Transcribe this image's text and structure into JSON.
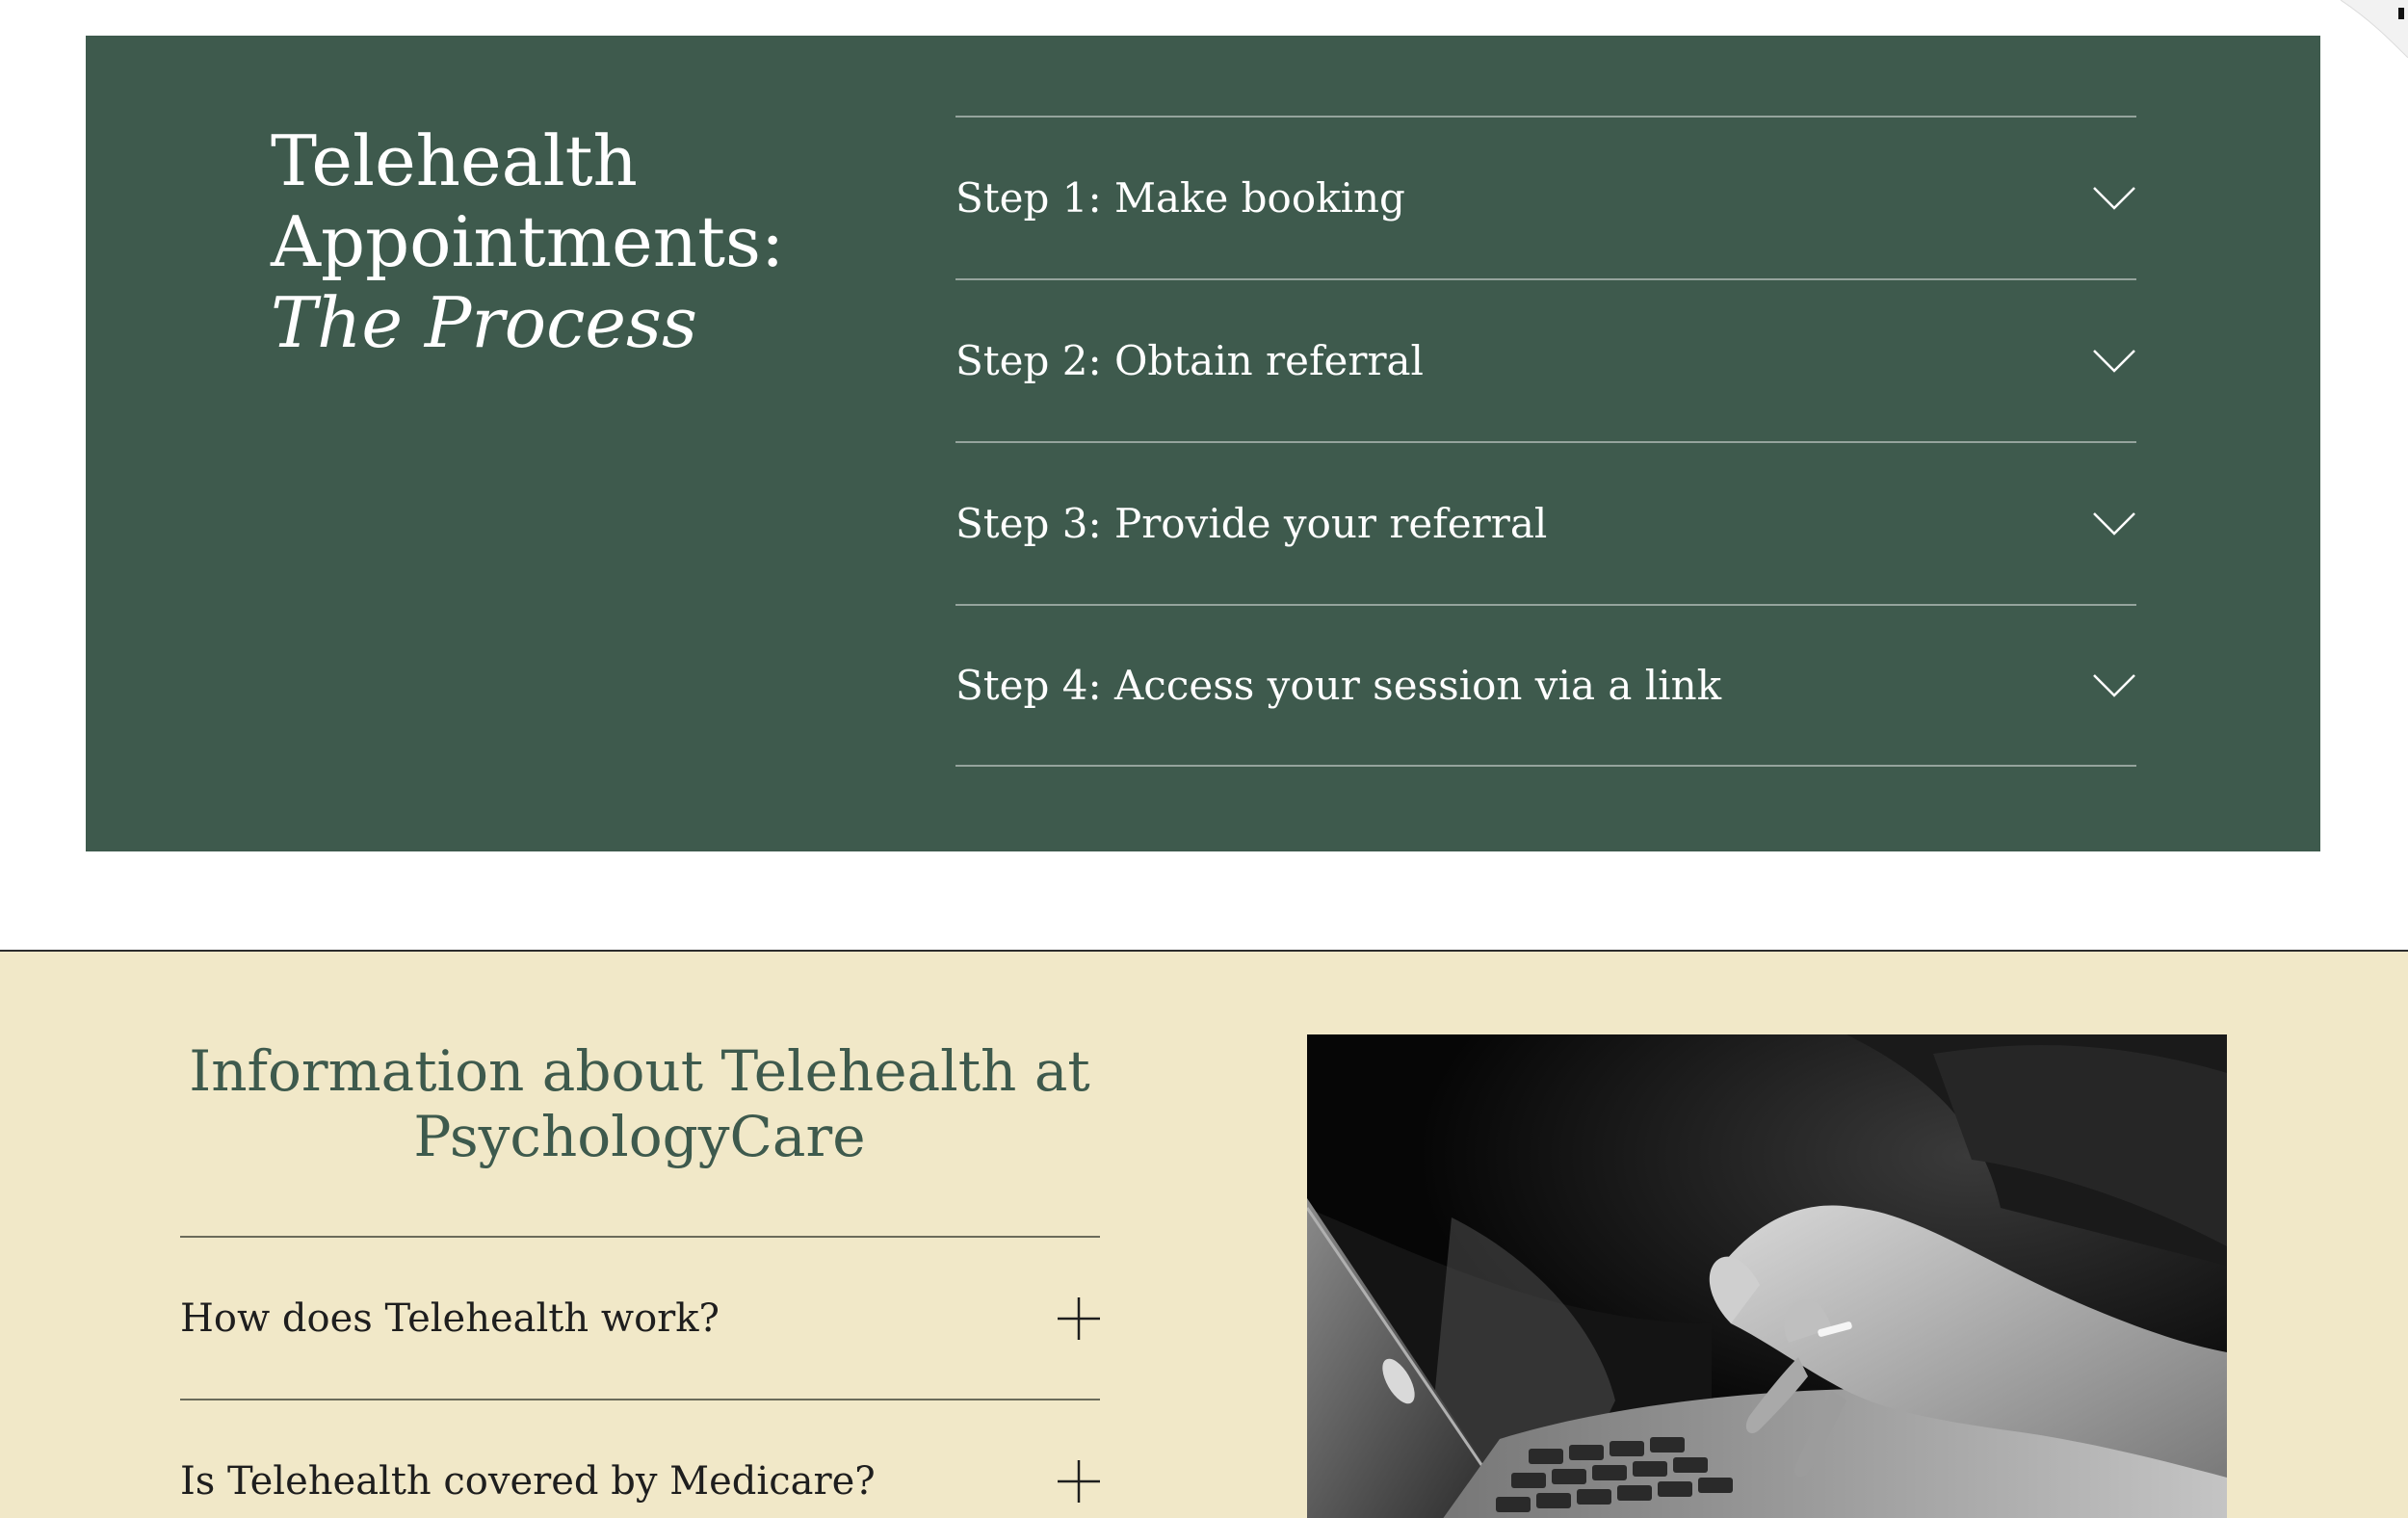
{
  "process": {
    "heading_line1": "Telehealth",
    "heading_line2": "Appointments:",
    "heading_line3": "The Process",
    "steps": [
      {
        "label": "Step 1: Make booking",
        "icon": "chevron-down-icon"
      },
      {
        "label": "Step 2: Obtain referral",
        "icon": "chevron-down-icon"
      },
      {
        "label": "Step 3: Provide your referral",
        "icon": "chevron-down-icon"
      },
      {
        "label": "Step 4: Access your session via a link",
        "icon": "chevron-down-icon"
      }
    ]
  },
  "info": {
    "title": "Information about Telehealth at PsychologyCare",
    "faqs": [
      {
        "label": "How does Telehealth work?",
        "icon": "plus-icon"
      },
      {
        "label": "Is Telehealth covered by Medicare?",
        "icon": "plus-icon"
      }
    ],
    "photo": "laptop-hands-photo"
  },
  "colors": {
    "panel_green": "#3e5a4d",
    "section_beige": "#f1e8c8",
    "title_green": "#3e5a4d",
    "text_dark": "#1e1e1e"
  }
}
